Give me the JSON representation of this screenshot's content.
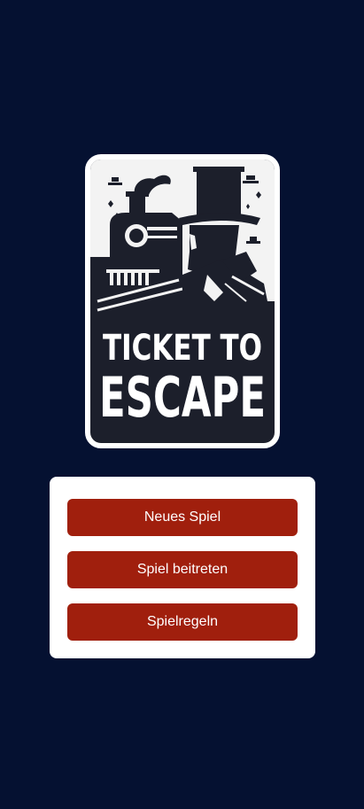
{
  "logo": {
    "line1": "TICKET TO",
    "line2": "ESCAPE"
  },
  "menu": {
    "new_game_label": "Neues Spiel",
    "join_game_label": "Spiel beitreten",
    "rules_label": "Spielregeln"
  },
  "colors": {
    "background": "#051131",
    "panel": "#ffffff",
    "button": "#a01f0d",
    "button_text": "#ffffff",
    "logo_dark": "#1c1f2b",
    "logo_light": "#ffffff"
  }
}
